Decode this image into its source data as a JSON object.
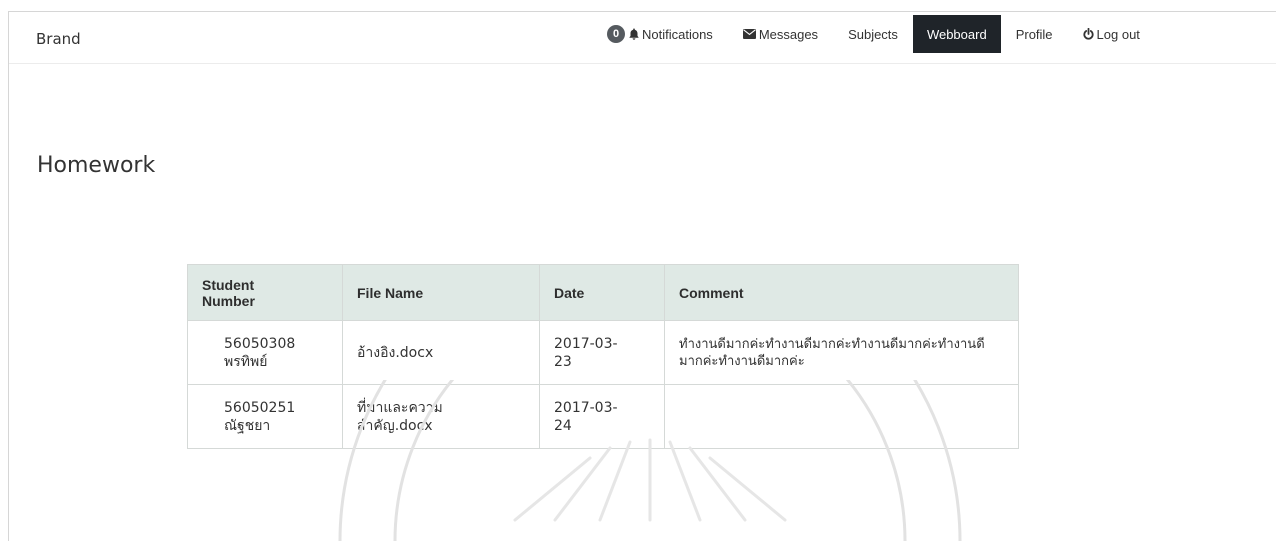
{
  "navbar": {
    "brand": "Brand",
    "notifications": {
      "count": "0",
      "label": "Notifications"
    },
    "messages_label": "Messages",
    "subjects_label": "Subjects",
    "webboard_label": "Webboard",
    "profile_label": "Profile",
    "logout_label": "Log out",
    "active_item": "Webboard"
  },
  "page": {
    "title": "Homework"
  },
  "table": {
    "headers": {
      "student_line1": "Student",
      "student_line2": "Number",
      "file_name": "File Name",
      "date": "Date",
      "comment": "Comment"
    },
    "rows": [
      {
        "student_number": "56050308",
        "student_name": "พรทิพย์",
        "file_name": "อ้างอิง.docx",
        "date_line1": "2017-03-",
        "date_line2": "23",
        "comment": "ทำงานดีมากค่ะทำงานดีมากค่ะทำงานดีมากค่ะทำงานดีมากค่ะทำงานดีมากค่ะ"
      },
      {
        "student_number": "56050251",
        "student_name": "ณัฐชยา",
        "file_name_line1": "ที่มาและความ",
        "file_name_line2": "สำคัญ.docx",
        "date_line1": "2017-03-",
        "date_line2": "24",
        "comment": ""
      }
    ]
  },
  "colors": {
    "active_nav_bg": "#1f2429",
    "table_header_bg": "#dfe9e5",
    "table_border": "#d5d9d7",
    "badge_bg": "#555a5f"
  },
  "icons": {
    "bell": "bell-icon",
    "envelope": "envelope-icon",
    "power": "power-icon"
  }
}
